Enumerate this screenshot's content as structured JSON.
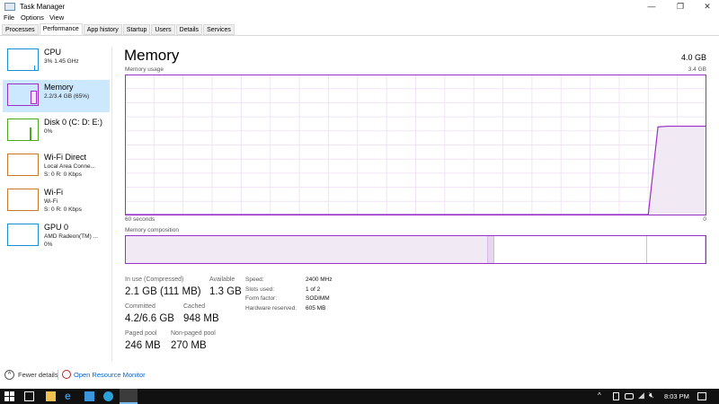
{
  "window": {
    "title": "Task Manager",
    "minimize": "—",
    "maximize": "❐",
    "close": "✕"
  },
  "menu": [
    "File",
    "Options",
    "View"
  ],
  "tabs": [
    "Processes",
    "Performance",
    "App history",
    "Startup",
    "Users",
    "Details",
    "Services"
  ],
  "sidebar": [
    {
      "name": "CPU",
      "line1": "3%  1.45 GHz",
      "line2": "",
      "color": "#1a8fd1"
    },
    {
      "name": "Memory",
      "line1": "2.2/3.4 GB (65%)",
      "line2": "",
      "color": "#9b30c9"
    },
    {
      "name": "Disk 0 (C: D: E:)",
      "line1": "0%",
      "line2": "",
      "color": "#4da81f"
    },
    {
      "name": "Wi-Fi Direct",
      "line1": "Local Area Conne...",
      "line2": "S: 0 R: 0 Kbps",
      "color": "#c8792e"
    },
    {
      "name": "Wi-Fi",
      "line1": "Wi-Fi",
      "line2": "S: 0 R: 0 Kbps",
      "color": "#c8792e"
    },
    {
      "name": "GPU 0",
      "line1": "AMD Radeon(TM) ...",
      "line2": "0%",
      "color": "#1a8fd1"
    }
  ],
  "main": {
    "heading": "Memory",
    "total": "4.0 GB",
    "usage_label": "Memory usage",
    "usage_max": "3.4 GB",
    "x_left": "60 seconds",
    "x_right": "0",
    "composition_label": "Memory composition",
    "usage_history_percent": [
      0,
      0,
      0,
      0,
      0,
      0,
      0,
      0,
      0,
      0,
      0,
      0,
      0,
      0,
      0,
      0,
      0,
      0,
      0,
      0,
      0,
      0,
      0,
      0,
      0,
      0,
      0,
      0,
      0,
      0,
      0,
      0,
      0,
      0,
      0,
      0,
      0,
      0,
      0,
      0,
      0,
      0,
      0,
      0,
      0,
      0,
      0,
      0,
      0,
      0,
      0,
      0,
      0,
      0,
      0,
      63,
      63.5,
      63.5,
      63.5,
      63.5,
      63.5
    ],
    "composition_percent": {
      "in_use": 62.5,
      "modified": 1,
      "standby": 26.5,
      "free": 10
    },
    "stats": [
      {
        "label": "In use (Compressed)",
        "value": "2.1 GB (111 MB)"
      },
      {
        "label": "Available",
        "value": "1.3 GB"
      },
      {
        "label": "Committed",
        "value": "4.2/6.6 GB"
      },
      {
        "label": "Cached",
        "value": "948 MB"
      },
      {
        "label": "Paged pool",
        "value": "246 MB"
      },
      {
        "label": "Non-paged pool",
        "value": "270 MB"
      }
    ],
    "props": [
      {
        "label": "Speed:",
        "value": "2400 MHz"
      },
      {
        "label": "Slots used:",
        "value": "1 of 2"
      },
      {
        "label": "Form factor:",
        "value": "SODIMM"
      },
      {
        "label": "Hardware reserved:",
        "value": "605 MB"
      }
    ]
  },
  "footer": {
    "fewer": "Fewer details",
    "monitor": "Open Resource Monitor"
  },
  "taskbar": {
    "time": "8:03 PM"
  }
}
